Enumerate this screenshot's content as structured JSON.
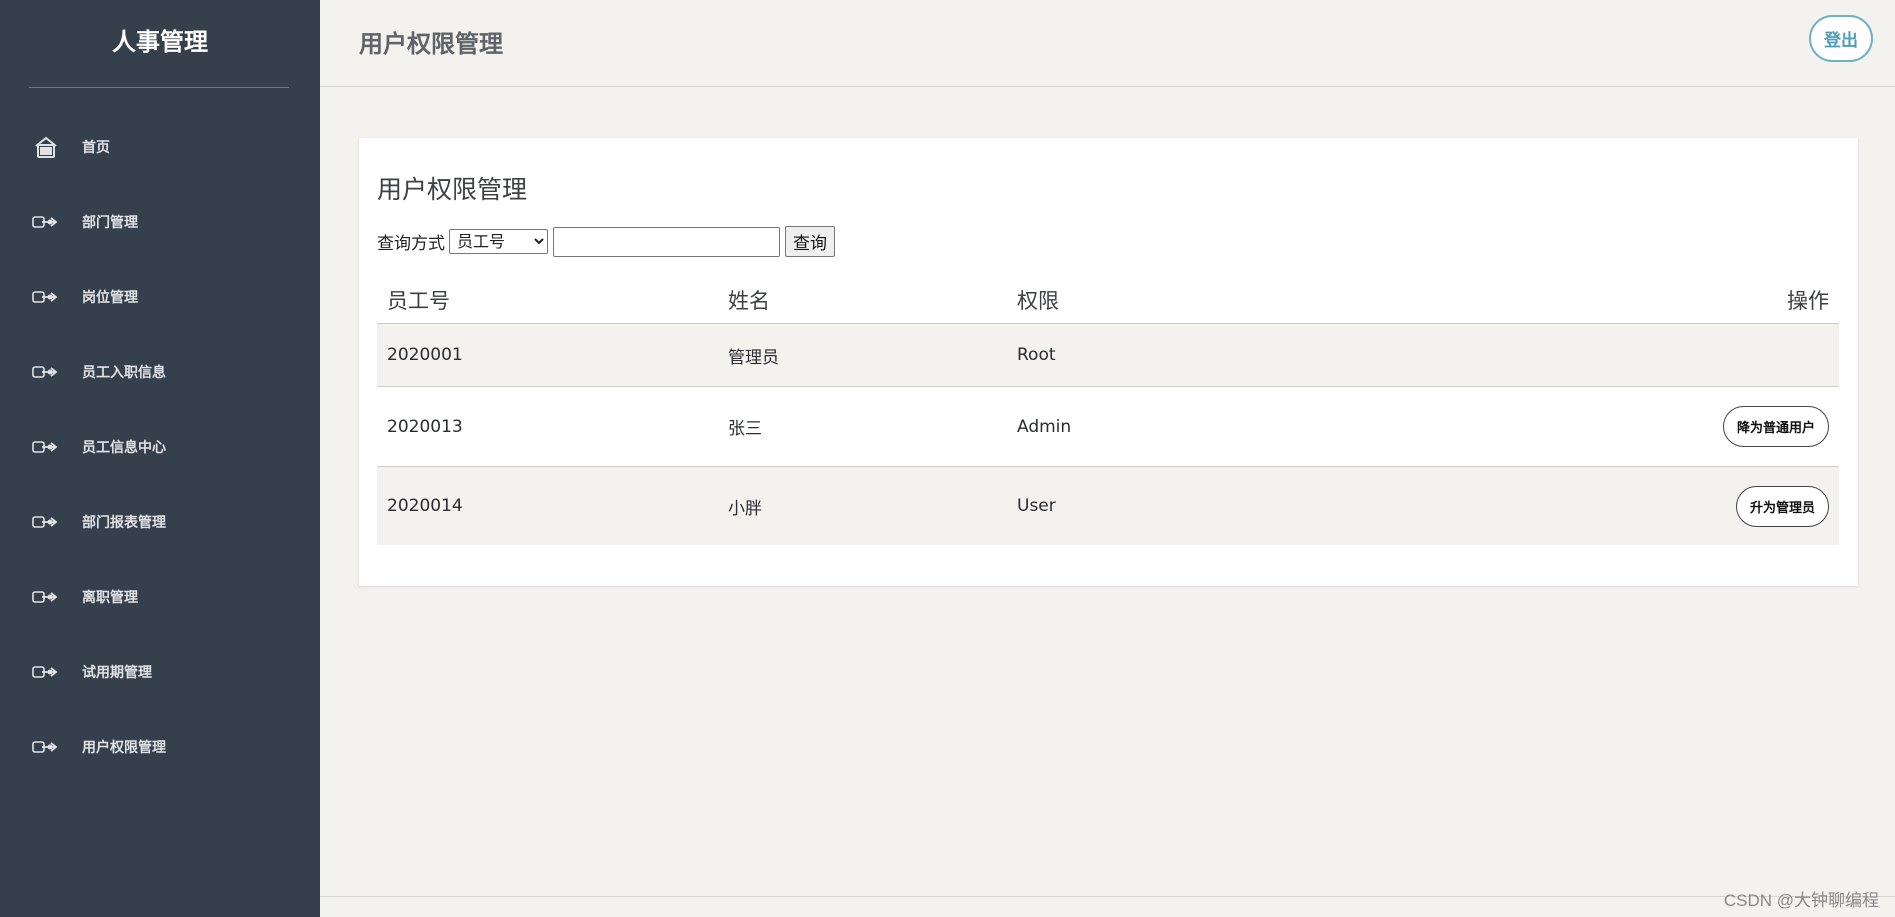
{
  "sidebar": {
    "brand": "人事管理",
    "items": [
      {
        "label": "首页",
        "icon": "home-icon"
      },
      {
        "label": "部门管理",
        "icon": "arrow-right-icon"
      },
      {
        "label": "岗位管理",
        "icon": "arrow-right-icon"
      },
      {
        "label": "员工入职信息",
        "icon": "arrow-right-icon"
      },
      {
        "label": "员工信息中心",
        "icon": "arrow-right-icon"
      },
      {
        "label": "部门报表管理",
        "icon": "arrow-right-icon"
      },
      {
        "label": "离职管理",
        "icon": "arrow-right-icon"
      },
      {
        "label": "试用期管理",
        "icon": "arrow-right-icon"
      },
      {
        "label": "用户权限管理",
        "icon": "arrow-right-icon"
      }
    ]
  },
  "header": {
    "title": "用户权限管理",
    "logout_label": "登出"
  },
  "main": {
    "card_title": "用户权限管理",
    "query": {
      "label": "查询方式",
      "selected": "员工号",
      "input_value": "",
      "button_label": "查询"
    },
    "table": {
      "headers": [
        "员工号",
        "姓名",
        "权限",
        "操作"
      ],
      "rows": [
        {
          "id": "2020001",
          "name": "管理员",
          "role": "Root",
          "action": ""
        },
        {
          "id": "2020013",
          "name": "张三",
          "role": "Admin",
          "action": "降为普通用户"
        },
        {
          "id": "2020014",
          "name": "小胖",
          "role": "User",
          "action": "升为管理员"
        }
      ]
    }
  },
  "watermark": "CSDN @大钟聊编程",
  "colors": {
    "sidebar_bg": "#36404d",
    "page_bg": "#f3f2ee",
    "accent": "#4f9db7"
  }
}
